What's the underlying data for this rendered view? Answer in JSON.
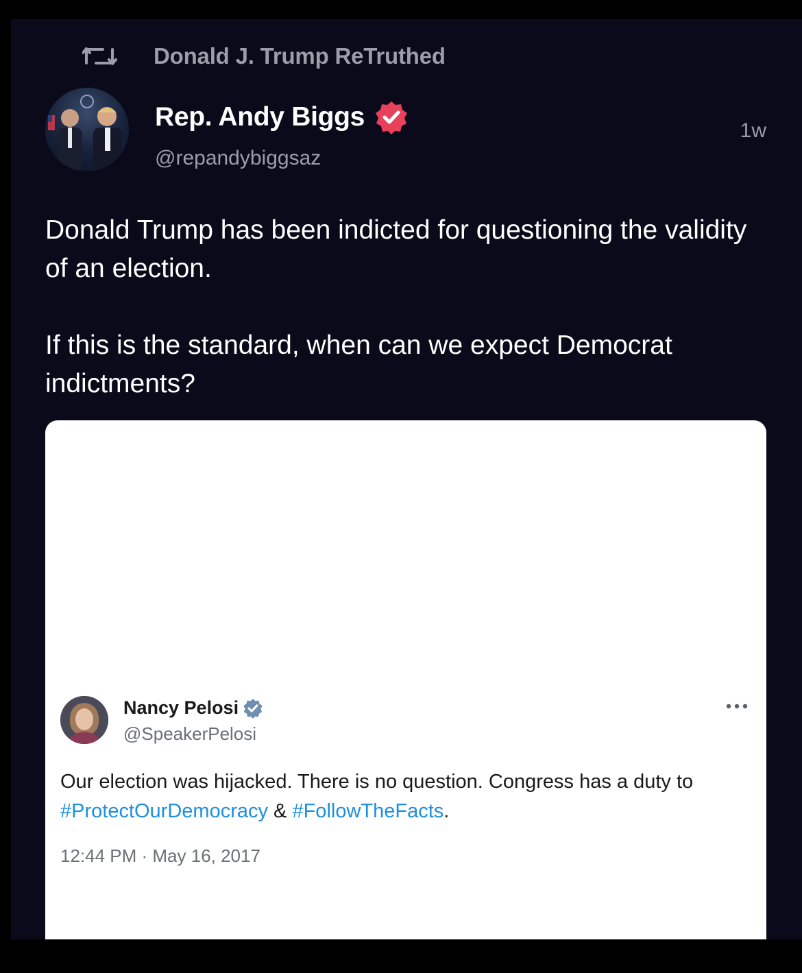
{
  "retruth": {
    "label": "Donald J. Trump ReTruthed",
    "icon": "retruth-icon"
  },
  "author": {
    "name": "Rep. Andy Biggs",
    "handle": "@repandybiggsaz",
    "verified_icon": "verified-badge-icon",
    "verified_color": "#e8415c"
  },
  "post": {
    "timestamp": "1w",
    "paragraphs": [
      "Donald Trump has been indicted for questioning the validity of an election.",
      "If this is the standard, when can we expect Democrat indictments?"
    ]
  },
  "embed": {
    "name": "Nancy Pelosi",
    "handle": "@SpeakerPelosi",
    "verified_color": "#6f8fb0",
    "text_before": "Our election was hijacked. There is no question. Congress has a duty to ",
    "hashtag_1": "#ProtectOurDemocracy",
    "text_between": " & ",
    "hashtag_2": "#FollowTheFacts",
    "text_after": ".",
    "time": "12:44 PM · May 16, 2017",
    "hashtag_color": "#1d8fe0"
  },
  "colors": {
    "background": "#0b0a1b",
    "muted_text": "#9d9ca8",
    "card": "#ffffff"
  }
}
